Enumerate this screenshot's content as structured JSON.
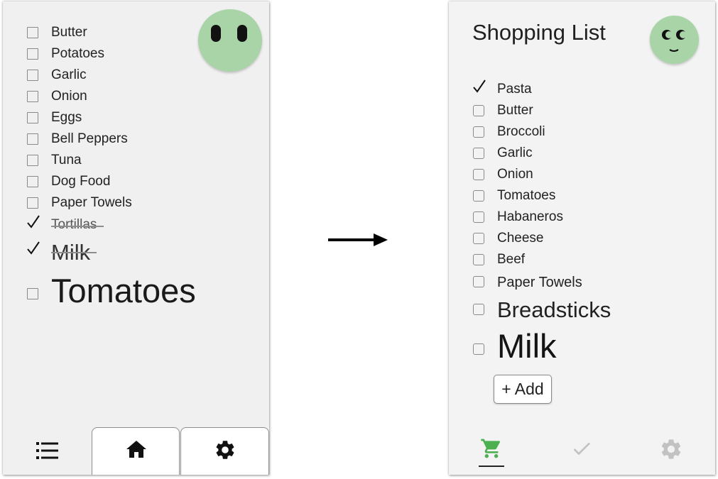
{
  "left_screen": {
    "items": [
      {
        "label": "Butter",
        "checked": false
      },
      {
        "label": "Potatoes",
        "checked": false
      },
      {
        "label": "Garlic",
        "checked": false
      },
      {
        "label": "Onion",
        "checked": false
      },
      {
        "label": "Eggs",
        "checked": false
      },
      {
        "label": "Bell Peppers",
        "checked": false
      },
      {
        "label": "Tuna",
        "checked": false
      },
      {
        "label": "Dog Food",
        "checked": false
      },
      {
        "label": "Paper Towels",
        "checked": false
      },
      {
        "label": "Tortillas",
        "checked": true
      },
      {
        "label": "Milk",
        "checked": true
      },
      {
        "label": "Tomatoes",
        "checked": false
      }
    ],
    "avatar_color": "#a8d4a8",
    "nav": [
      {
        "icon": "list-icon",
        "selected": true
      },
      {
        "icon": "home-icon",
        "selected": false
      },
      {
        "icon": "gear-icon",
        "selected": false
      }
    ]
  },
  "right_screen": {
    "title": "Shopping List",
    "items": [
      {
        "label": "Pasta",
        "checked": true
      },
      {
        "label": "Butter",
        "checked": false
      },
      {
        "label": "Broccoli",
        "checked": false
      },
      {
        "label": "Garlic",
        "checked": false
      },
      {
        "label": "Onion",
        "checked": false
      },
      {
        "label": "Tomatoes",
        "checked": false
      },
      {
        "label": "Habaneros",
        "checked": false
      },
      {
        "label": "Cheese",
        "checked": false
      },
      {
        "label": "Beef",
        "checked": false
      },
      {
        "label": "Paper Towels",
        "checked": false
      },
      {
        "label": "Breadsticks",
        "checked": false
      },
      {
        "label": "Milk",
        "checked": false
      }
    ],
    "add_label": "+ Add",
    "avatar_color": "#a8d4a8",
    "nav": [
      {
        "icon": "cart-icon",
        "selected": true
      },
      {
        "icon": "checkmark-icon",
        "selected": false
      },
      {
        "icon": "gear-icon",
        "selected": false
      }
    ],
    "accent_color": "#4caf50"
  }
}
